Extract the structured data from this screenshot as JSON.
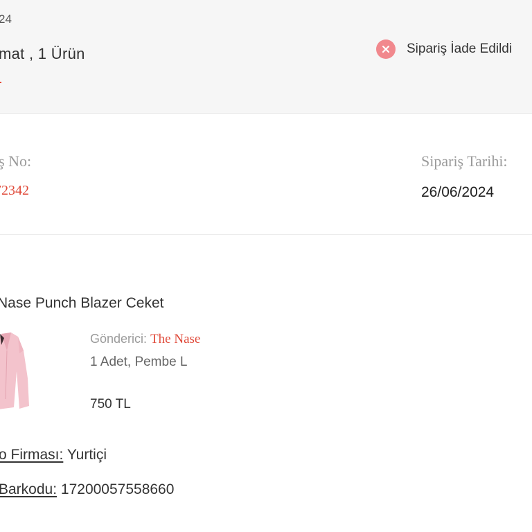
{
  "header": {
    "date_partial": "24",
    "summary": "mat , 1 Ürün",
    "status": {
      "icon": "close-circle-icon",
      "text": "Sipariş İade Edildi",
      "color": "#f1888d"
    }
  },
  "order_info": {
    "order_no_label": "iş No:",
    "order_no_value": "72342",
    "order_date_label": "Sipariş Tarihi:",
    "order_date_value": "26/06/2024"
  },
  "product": {
    "name": "Nase Punch Blazer Ceket",
    "sender_label": "Gönderici:",
    "sender_name": "The Nase",
    "qty_variant": "1 Adet, Pembe L",
    "price": "750 TL"
  },
  "shipping": {
    "carrier_label": "o Firması:",
    "carrier_value": "Yurtiçi",
    "barcode_label": "Barkodu:",
    "barcode_value": "17200057558660"
  },
  "colors": {
    "accent": "#e04a3a",
    "header_bg": "#f6f6f6",
    "product_pink": "#f3c3cc"
  }
}
